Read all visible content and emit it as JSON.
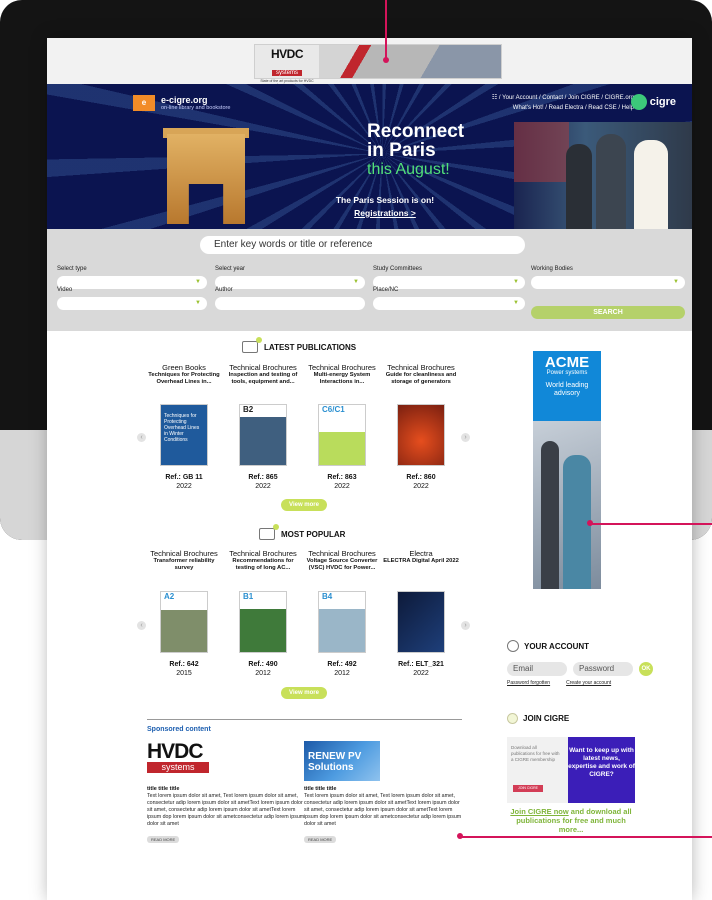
{
  "colors": {
    "accent_green": "#c8e05a",
    "banner_blue": "#0b1450",
    "callout": "#d4145a",
    "cigre_blue": "#1188d8"
  },
  "ad_top": {
    "title": "HVDC",
    "subtitle": "systems",
    "caption": "State of the art products for HVDC developments"
  },
  "header": {
    "brand_name": "e-cigre.org",
    "brand_tagline": "on-line library and bookstore",
    "links_line1": "☷ / Your Account / Contact / Join CIGRE / CIGRE.org",
    "links_line2": "What's Hot! / Read Electra / Read CSE / Help",
    "cigre_logo_text": "cigre"
  },
  "banner": {
    "headline_line1": "Reconnect",
    "headline_line2": "in Paris",
    "headline_line3": "this August!",
    "session": "The Paris Session is on!",
    "registrations": "Registrations >"
  },
  "search": {
    "placeholder": "Enter key words or title or reference",
    "fields": [
      {
        "label": "Select type",
        "value": ""
      },
      {
        "label": "Select year",
        "value": ""
      },
      {
        "label": "Study Committees",
        "value": ""
      },
      {
        "label": "Working Bodies",
        "value": ""
      },
      {
        "label": "Video",
        "value": ""
      },
      {
        "label": "Author",
        "value": ""
      },
      {
        "label": "Place/NC",
        "value": ""
      }
    ],
    "button": "SEARCH"
  },
  "latest": {
    "title": "LATEST PUBLICATIONS",
    "items": [
      {
        "category": "Green Books",
        "title": "Techniques for Protecting Overhead Lines in...",
        "ref": "Ref.: GB 11",
        "year": "2022"
      },
      {
        "category": "Technical Brochures",
        "title": "Inspection and testing of tools, equipment and...",
        "ref": "Ref.: 865",
        "year": "2022"
      },
      {
        "category": "Technical Brochures",
        "title": "Multi-energy System Interactions in...",
        "ref": "Ref.: 863",
        "year": "2022"
      },
      {
        "category": "Technical Brochures",
        "title": "Guide for cleanliness and storage of generators",
        "ref": "Ref.: 860",
        "year": "2022"
      }
    ],
    "cover_texts": [
      "Techniques for Protecting Overhead Lines in Winter Conditions",
      "B2",
      "C6/C1",
      ""
    ],
    "view_more": "View more"
  },
  "popular": {
    "title": "MOST POPULAR",
    "items": [
      {
        "category": "Technical Brochures",
        "title": "Transformer reliability survey",
        "ref": "Ref.: 642",
        "year": "2015"
      },
      {
        "category": "Technical Brochures",
        "title": "Recommendations for testing of long AC...",
        "ref": "Ref.: 490",
        "year": "2012"
      },
      {
        "category": "Technical Brochures",
        "title": "Voltage Source Converter (VSC) HVDC for Power...",
        "ref": "Ref.: 492",
        "year": "2012"
      },
      {
        "category": "Electra",
        "title": "ELECTRA Digital April 2022",
        "ref": "Ref.: ELT_321",
        "year": "2022"
      }
    ],
    "cover_texts": [
      "A2",
      "B1",
      "B4",
      ""
    ],
    "view_more": "View more"
  },
  "ad_side": {
    "brand": "ACME",
    "sub": "Power systems",
    "tagline": "World leading advisory"
  },
  "account": {
    "title": "YOUR ACCOUNT",
    "email_placeholder": "Email",
    "password_placeholder": "Password",
    "ok": "OK",
    "forgotten": "Password forgotten",
    "create": "Create your account"
  },
  "join": {
    "title": "JOIN CIGRE",
    "box_text": "Download all publications for free with a CIGRE membership",
    "box_button": "JOIN CIGRE",
    "promo": "Want to keep up with latest news, expertise and work of CIGRE?",
    "link": "Join CIGRE now",
    "text_rest": " and download all publications for free and much more..."
  },
  "sponsored": {
    "title": "Sponsored content",
    "logo_word": "HVDC",
    "logo_sub": "systems",
    "image_text": "RENEW PV Solutions",
    "items": [
      {
        "heading": "title title title",
        "body": "Text lorem ipsum dolor sit amet, Text lorem ipsum dolor sit amet, consectetur adip lorem ipsum dolor sit ametText lorem ipsum dolor sit amet, consectetur adip lorem ipsum dolor sit ametText lorem ipsum dop lorem ipsum dolor sit ametconsectetur adip lorem ipsum dolor sit amet",
        "button": "READ MORE"
      },
      {
        "heading": "title title title",
        "body": "Text lorem ipsum dolor sit amet, Text lorem ipsum dolor sit amet, consectetur adip lorem ipsum dolor sit ametText lorem ipsum dolor sit amet, consectetur adip lorem ipsum dolor sit ametText lorem ipsum dop lorem ipsum dolor sit ametconsectetur adip lorem ipsum dolor sit amet",
        "button": "READ MORE"
      }
    ]
  }
}
